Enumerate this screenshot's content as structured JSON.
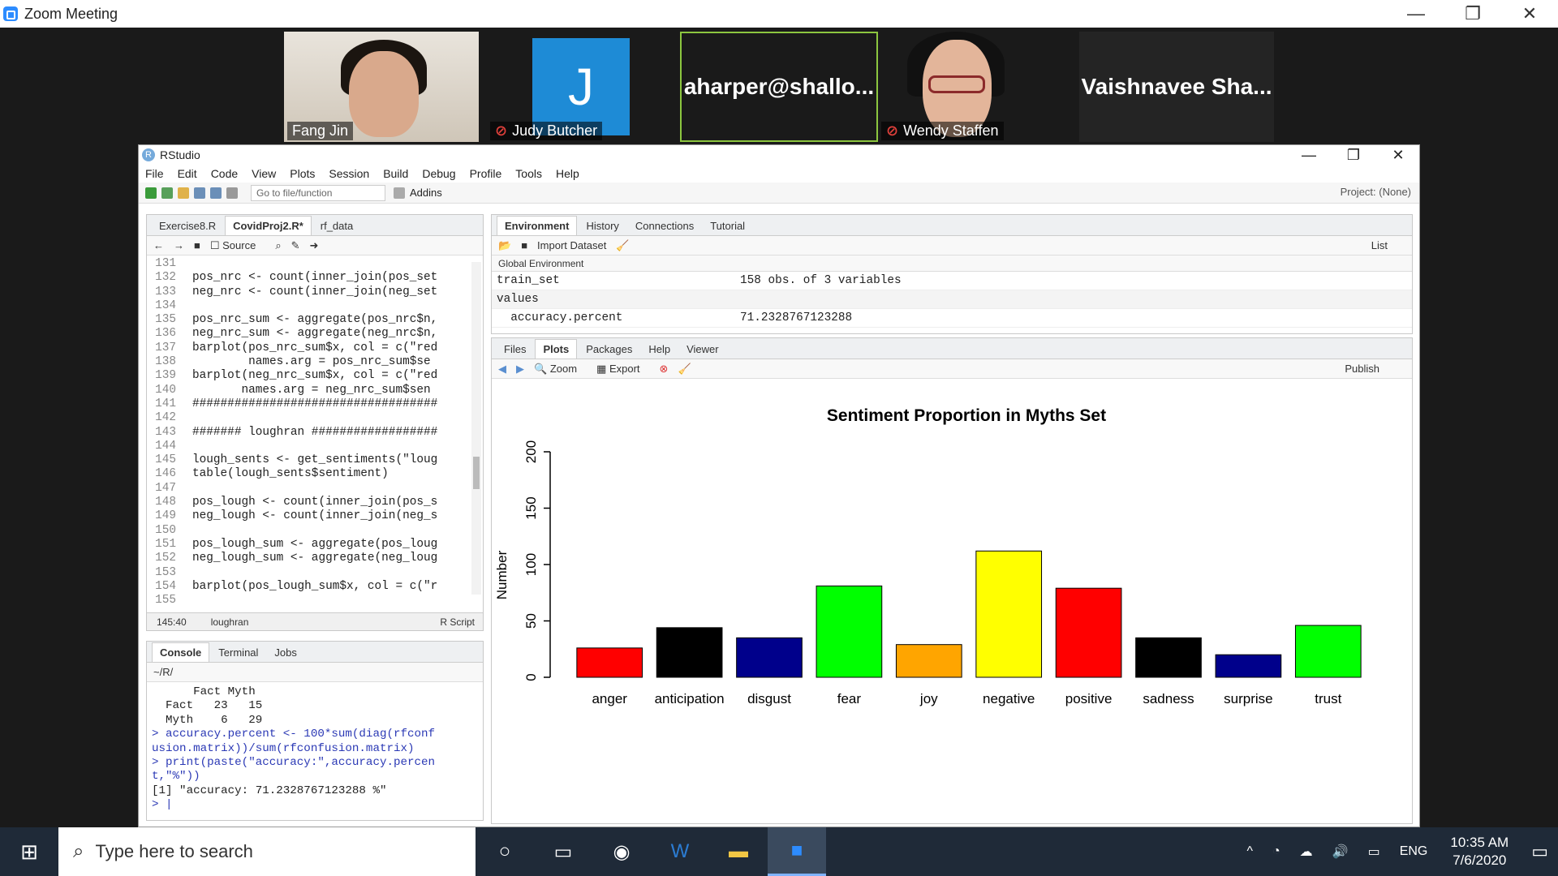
{
  "zoom": {
    "window_title": "Zoom Meeting",
    "participants": [
      {
        "name": "Fang Jin",
        "muted": false
      },
      {
        "name": "Judy Butcher",
        "muted": true,
        "avatar_letter": "J"
      },
      {
        "name": "aharper@shallo..."
      },
      {
        "name": "Wendy Staffen",
        "muted": true
      },
      {
        "name": "Vaishnavee  Sha..."
      }
    ]
  },
  "rstudio": {
    "title": "RStudio",
    "menu": [
      "File",
      "Edit",
      "Code",
      "View",
      "Plots",
      "Session",
      "Build",
      "Debug",
      "Profile",
      "Tools",
      "Help"
    ],
    "toolbar": {
      "goto_placeholder": "Go to file/function",
      "addins": "Addins",
      "project": "Project: (None)"
    },
    "editor": {
      "tabs": [
        "Exercise8.R",
        "CovidProj2.R*",
        "rf_data"
      ],
      "toolbar": {
        "source": "Source"
      },
      "lines": [
        {
          "n": "131",
          "t": ""
        },
        {
          "n": "132",
          "t": "pos_nrc <- count(inner_join(pos_set"
        },
        {
          "n": "133",
          "t": "neg_nrc <- count(inner_join(neg_set"
        },
        {
          "n": "134",
          "t": ""
        },
        {
          "n": "135",
          "t": "pos_nrc_sum <- aggregate(pos_nrc$n,"
        },
        {
          "n": "136",
          "t": "neg_nrc_sum <- aggregate(neg_nrc$n,"
        },
        {
          "n": "137",
          "t": "barplot(pos_nrc_sum$x, col = c(\"red"
        },
        {
          "n": "138",
          "t": "        names.arg = pos_nrc_sum$se"
        },
        {
          "n": "139",
          "t": "barplot(neg_nrc_sum$x, col = c(\"red"
        },
        {
          "n": "140",
          "t": "       names.arg = neg_nrc_sum$sen"
        },
        {
          "n": "141",
          "t": "###################################"
        },
        {
          "n": "142",
          "t": ""
        },
        {
          "n": "143",
          "t": "####### loughran ##################"
        },
        {
          "n": "144",
          "t": ""
        },
        {
          "n": "145",
          "t": "lough_sents <- get_sentiments(\"loug"
        },
        {
          "n": "146",
          "t": "table(lough_sents$sentiment)"
        },
        {
          "n": "147",
          "t": ""
        },
        {
          "n": "148",
          "t": "pos_lough <- count(inner_join(pos_s"
        },
        {
          "n": "149",
          "t": "neg_lough <- count(inner_join(neg_s"
        },
        {
          "n": "150",
          "t": ""
        },
        {
          "n": "151",
          "t": "pos_lough_sum <- aggregate(pos_loug"
        },
        {
          "n": "152",
          "t": "neg_lough_sum <- aggregate(neg_loug"
        },
        {
          "n": "153",
          "t": ""
        },
        {
          "n": "154",
          "t": "barplot(pos_lough_sum$x, col = c(\"r"
        },
        {
          "n": "155",
          "t": ""
        }
      ],
      "status_pos": "145:40",
      "status_section": "loughran",
      "status_type": "R Script"
    },
    "console": {
      "tabs": [
        "Console",
        "Terminal",
        "Jobs"
      ],
      "path": "~/R/",
      "lines": [
        {
          "t": "      Fact Myth",
          "cls": ""
        },
        {
          "t": "  Fact   23   15",
          "cls": ""
        },
        {
          "t": "  Myth    6   29",
          "cls": ""
        },
        {
          "t": "> accuracy.percent <- 100*sum(diag(rfconf",
          "cls": "cmd"
        },
        {
          "t": "usion.matrix))/sum(rfconfusion.matrix)",
          "cls": "cmd"
        },
        {
          "t": "> print(paste(\"accuracy:\",accuracy.percen",
          "cls": "cmd"
        },
        {
          "t": "t,\"%\"))",
          "cls": "cmd"
        },
        {
          "t": "[1] \"accuracy: 71.2328767123288 %\"",
          "cls": ""
        },
        {
          "t": "> |",
          "cls": "cmd"
        }
      ]
    },
    "environment": {
      "tabs": [
        "Environment",
        "History",
        "Connections",
        "Tutorial"
      ],
      "import_label": "Import Dataset",
      "list_label": "List",
      "scope": "Global Environment",
      "rows": [
        {
          "name": "train_set",
          "value": "158 obs. of 3 variables"
        },
        {
          "name": "values",
          "value": ""
        },
        {
          "name": "  accuracy.percent",
          "value": "71.2328767123288"
        }
      ]
    },
    "plots": {
      "tabs": [
        "Files",
        "Plots",
        "Packages",
        "Help",
        "Viewer"
      ],
      "zoom_label": "Zoom",
      "export_label": "Export",
      "publish_label": "Publish"
    }
  },
  "chart_data": {
    "type": "bar",
    "title": "Sentiment Proportion in Myths Set",
    "xlabel": "",
    "ylabel": "Number",
    "ylim": [
      0,
      200
    ],
    "yticks": [
      "0",
      "50",
      "100",
      "150",
      "200"
    ],
    "categories": [
      "anger",
      "anticipation",
      "disgust",
      "fear",
      "joy",
      "negative",
      "positive",
      "sadness",
      "surprise",
      "trust"
    ],
    "values": [
      26,
      44,
      35,
      81,
      29,
      112,
      79,
      35,
      20,
      46
    ],
    "colors": [
      "#ff0000",
      "#000000",
      "#00008b",
      "#00ff00",
      "#ffa500",
      "#ffff00",
      "#ff0000",
      "#000000",
      "#00008b",
      "#00ff00"
    ]
  },
  "taskbar": {
    "search_placeholder": "Type here to search",
    "lang": "ENG",
    "time": "10:35 AM",
    "date": "7/6/2020"
  }
}
